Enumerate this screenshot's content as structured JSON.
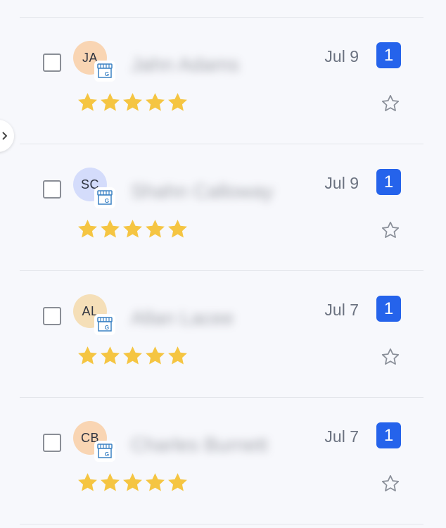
{
  "colors": {
    "accent": "#2563eb",
    "star": "#f5c542",
    "avatar_peach": "#f9d5b3",
    "avatar_lavender": "#d4dcfb",
    "avatar_sand": "#f5dfb8"
  },
  "reviews": [
    {
      "initials": "JA",
      "avatar_color": "#f9d5b3",
      "name": "Jahn Adams",
      "date": "Jul 9",
      "count": "1",
      "rating": 5,
      "source_icon": "google-business-icon"
    },
    {
      "initials": "SC",
      "avatar_color": "#d4dcfb",
      "name": "Shahn Calloway",
      "date": "Jul 9",
      "count": "1",
      "rating": 5,
      "source_icon": "google-business-icon"
    },
    {
      "initials": "AL",
      "avatar_color": "#f5dfb8",
      "name": "Allan Lacee",
      "date": "Jul 7",
      "count": "1",
      "rating": 5,
      "source_icon": "google-business-icon"
    },
    {
      "initials": "CB",
      "avatar_color": "#f9d5b3",
      "name": "Charles Burnett",
      "date": "Jul 7",
      "count": "1",
      "rating": 5,
      "source_icon": "google-business-icon"
    }
  ]
}
